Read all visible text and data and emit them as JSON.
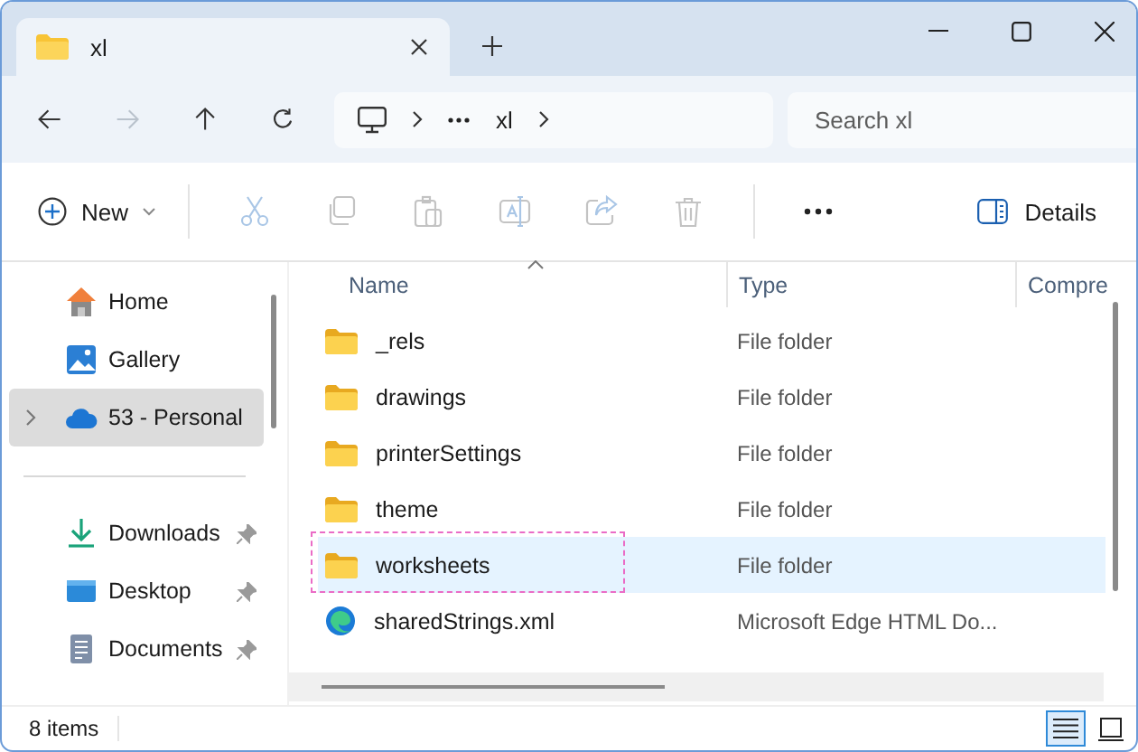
{
  "window": {
    "tab_title": "xl"
  },
  "nav": {
    "buttons": [
      {
        "kind": "back",
        "disabled": false
      },
      {
        "kind": "forward",
        "disabled": true
      },
      {
        "kind": "up",
        "disabled": false
      },
      {
        "kind": "refresh",
        "disabled": false
      }
    ]
  },
  "address": {
    "crumbs": [
      "xl"
    ]
  },
  "search": {
    "placeholder": "Search xl"
  },
  "toolbar": {
    "new_label": "New",
    "actions": [
      {
        "kind": "cut",
        "disabled": true
      },
      {
        "kind": "copy",
        "disabled": true
      },
      {
        "kind": "paste",
        "disabled": true
      },
      {
        "kind": "rename",
        "disabled": true
      },
      {
        "kind": "share",
        "disabled": true
      },
      {
        "kind": "delete",
        "disabled": true
      }
    ],
    "details_label": "Details"
  },
  "sidebar": {
    "items": [
      {
        "label": "Home",
        "kind": "home",
        "selected": false,
        "expandable": false,
        "pinned": false
      },
      {
        "label": "Gallery",
        "kind": "gallery",
        "selected": false,
        "expandable": false,
        "pinned": false
      },
      {
        "label": "53 - Personal",
        "kind": "cloud",
        "selected": true,
        "expandable": true,
        "pinned": false
      },
      {
        "kind": "separator"
      },
      {
        "label": "Downloads",
        "kind": "downloads",
        "selected": false,
        "expandable": false,
        "pinned": true
      },
      {
        "label": "Desktop",
        "kind": "desktop",
        "selected": false,
        "expandable": false,
        "pinned": true
      },
      {
        "label": "Documents",
        "kind": "documents",
        "selected": false,
        "expandable": false,
        "pinned": true
      }
    ]
  },
  "table": {
    "columns": [
      {
        "label": "Name",
        "sorted": true
      },
      {
        "label": "Type",
        "sorted": false
      },
      {
        "label": "Compre",
        "sorted": false
      }
    ],
    "rows": [
      {
        "name": "_rels",
        "type": "File folder",
        "kind": "folder",
        "selected": false,
        "marked": false
      },
      {
        "name": "drawings",
        "type": "File folder",
        "kind": "folder",
        "selected": false,
        "marked": false
      },
      {
        "name": "printerSettings",
        "type": "File folder",
        "kind": "folder",
        "selected": false,
        "marked": false
      },
      {
        "name": "theme",
        "type": "File folder",
        "kind": "folder",
        "selected": false,
        "marked": false
      },
      {
        "name": "worksheets",
        "type": "File folder",
        "kind": "folder",
        "selected": true,
        "marked": true
      },
      {
        "name": "sharedStrings.xml",
        "type": "Microsoft Edge HTML Do...",
        "kind": "edge",
        "selected": false,
        "marked": false
      }
    ]
  },
  "status_bar": {
    "count": "8 items",
    "views": [
      {
        "kind": "details",
        "selected": true
      },
      {
        "kind": "tiles",
        "selected": false
      }
    ]
  }
}
